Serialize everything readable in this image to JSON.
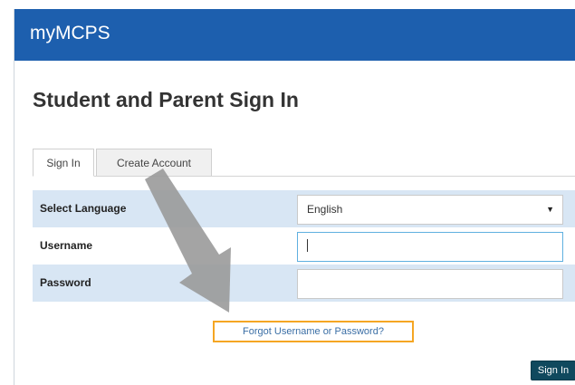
{
  "header": {
    "brand": "myMCPS"
  },
  "page": {
    "title": "Student and Parent Sign In"
  },
  "tabs": [
    {
      "label": "Sign In",
      "active": true
    },
    {
      "label": "Create Account",
      "active": false
    }
  ],
  "form": {
    "language": {
      "label": "Select Language",
      "selected": "English",
      "arrow_icon": "caret-down-icon"
    },
    "username": {
      "label": "Username",
      "value": "",
      "placeholder": ""
    },
    "password": {
      "label": "Password",
      "value": "",
      "placeholder": ""
    }
  },
  "links": {
    "forgot": "Forgot Username or Password?"
  },
  "actions": {
    "sign_in": "Sign In"
  },
  "colors": {
    "header_bg": "#1d5fae",
    "row_shade": "#d8e6f4",
    "highlight_border": "#f5a623",
    "button_bg": "#10495e",
    "annotation_arrow": "#9a9a9a"
  },
  "annotation": {
    "icon": "pointer-arrow-icon"
  }
}
